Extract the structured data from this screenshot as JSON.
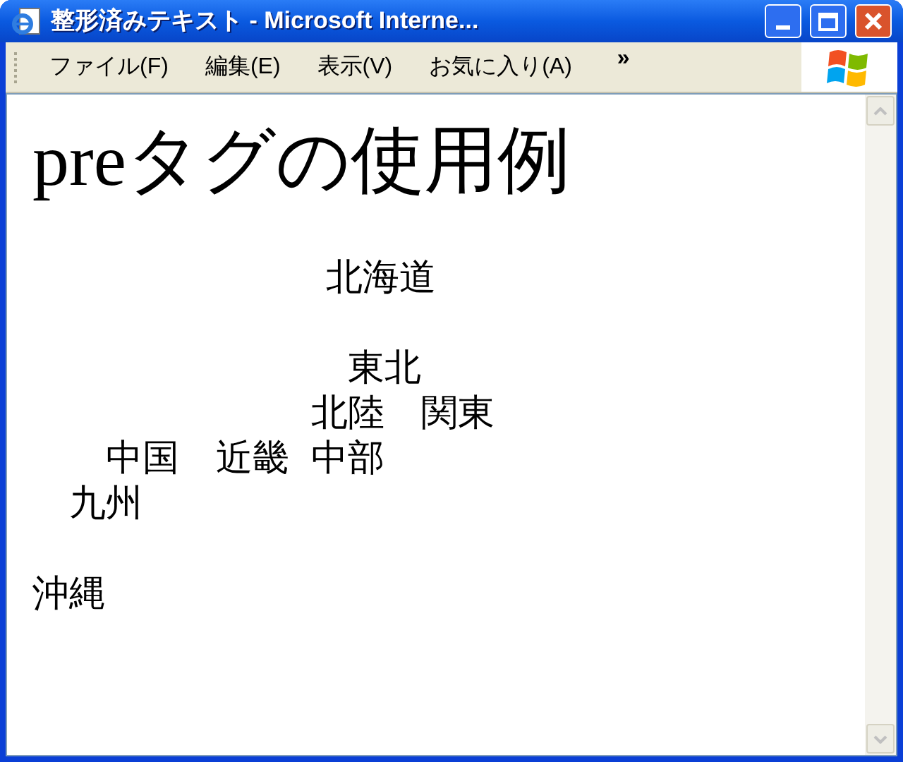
{
  "window": {
    "title": "整形済みテキスト - Microsoft Interne..."
  },
  "menu": [
    {
      "label": "ファイル(F)"
    },
    {
      "label": "編集(E)"
    },
    {
      "label": "表示(V)"
    },
    {
      "label": "お気に入り(A)"
    }
  ],
  "menu_overflow": "»",
  "page": {
    "heading": "preタグの使用例",
    "pre_paragraphs": [
      {
        "lines": [
          "　　　　　　　　北海道"
        ]
      },
      {
        "lines": [
          "　　　　　　　　 東北",
          "　　　　　　　 北陸　関東",
          "　　中国　近畿 中部",
          "　九州"
        ]
      },
      {
        "lines": [
          "沖縄"
        ]
      }
    ]
  }
}
